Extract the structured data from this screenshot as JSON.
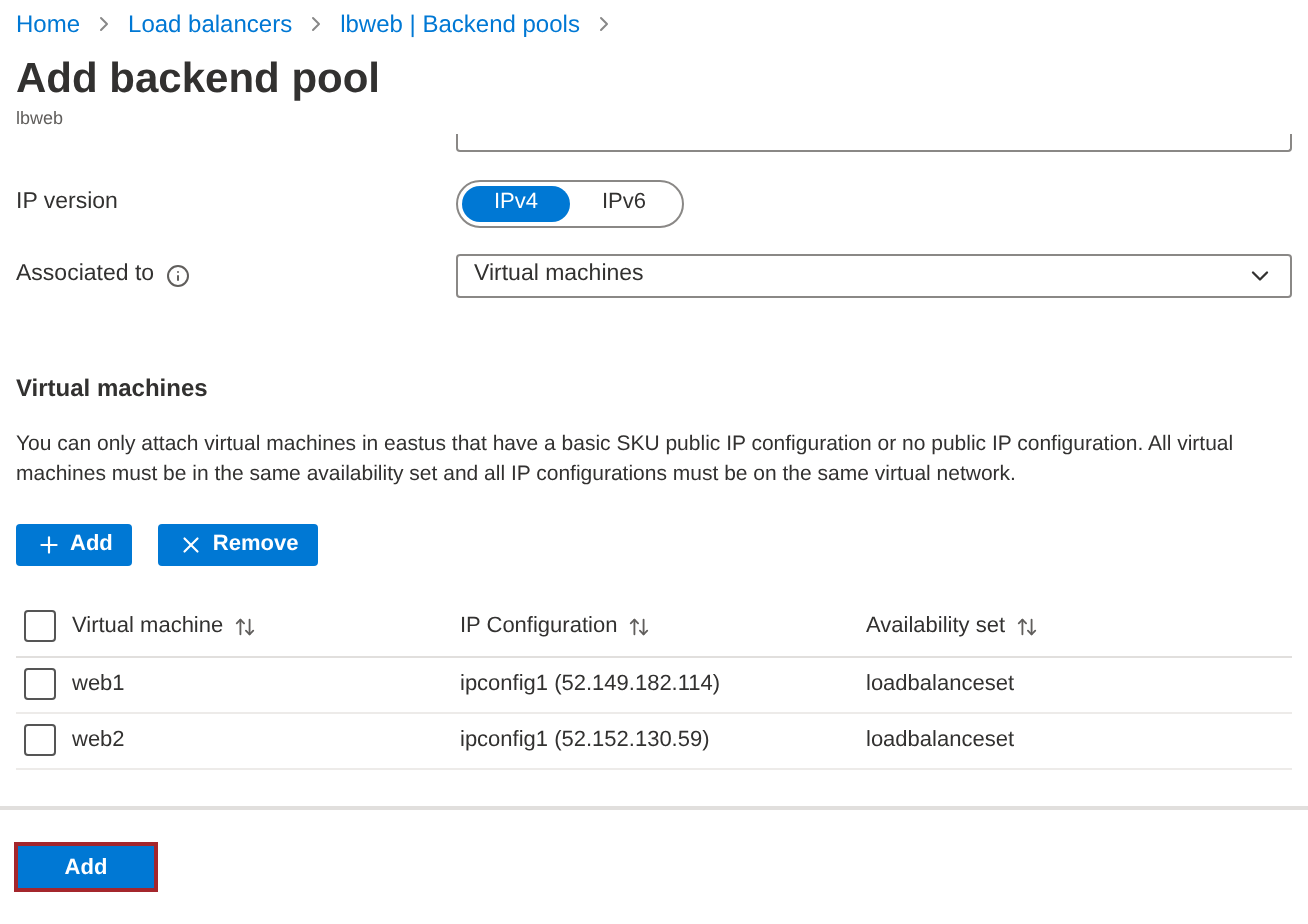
{
  "breadcrumb": [
    "Home",
    "Load balancers",
    "lbweb | Backend pools"
  ],
  "title": "Add backend pool",
  "subtitle": "lbweb",
  "fields": [
    {
      "kind": "toggle",
      "label": "IP version",
      "info": false,
      "options": [
        {
          "label": "IPv4",
          "selected": true
        },
        {
          "label": "IPv6",
          "selected": false
        }
      ]
    },
    {
      "kind": "dropdown",
      "label": "Associated to",
      "info": true,
      "value": "Virtual machines"
    }
  ],
  "section": {
    "title": "Virtual machines",
    "description": "You can only attach virtual machines in eastus that have a basic SKU public IP configuration or no public IP configuration. All virtual machines must be in the same availability set and all IP configurations must be on the same virtual network."
  },
  "toolbar": [
    {
      "kind": "add",
      "label": "Add"
    },
    {
      "kind": "remove",
      "label": "Remove"
    }
  ],
  "table": {
    "all_checked": false,
    "columns": [
      "Virtual machine",
      "IP Configuration",
      "Availability set"
    ],
    "rows": [
      {
        "checked": false,
        "cells": [
          "web1",
          "ipconfig1 (52.149.182.114)",
          "loadbalanceset"
        ]
      },
      {
        "checked": false,
        "cells": [
          "web2",
          "ipconfig1 (52.152.130.59)",
          "loadbalanceset"
        ]
      }
    ]
  },
  "submit": "Add"
}
